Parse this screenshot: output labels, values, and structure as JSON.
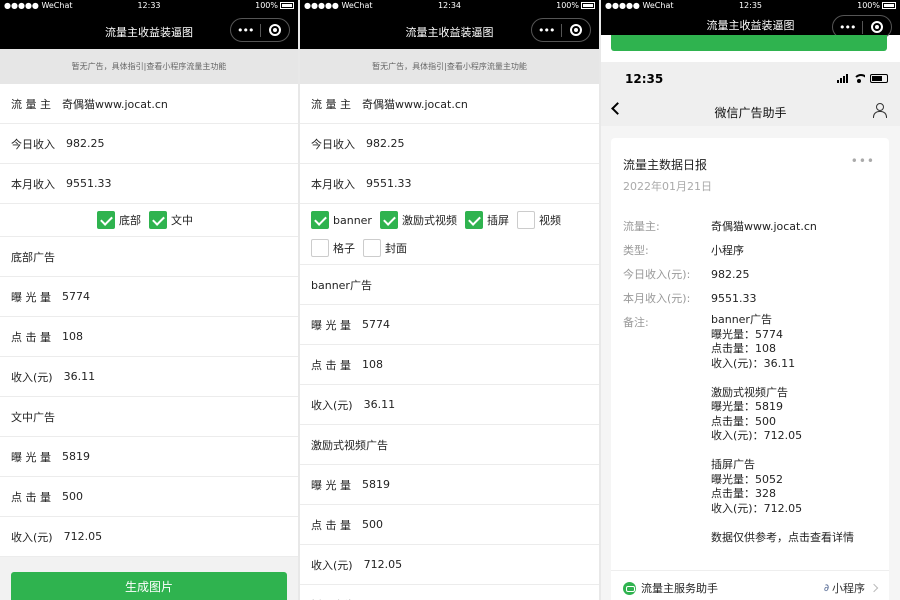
{
  "screens": [
    {
      "status": {
        "left": "●●●●● WeChat",
        "time": "12:33",
        "battery": "100%"
      },
      "nav_title": "流量主收益装逼图",
      "notice": "暂无广告，具体指引|查看小程序流量主功能",
      "rows_top": [
        {
          "label": "流 量 主",
          "value": "奇偶猫www.jocat.cn"
        },
        {
          "label": "今日收入",
          "value": "982.25"
        },
        {
          "label": "本月收入",
          "value": "9551.33"
        }
      ],
      "checks": [
        {
          "label": "底部",
          "checked": true
        },
        {
          "label": "文中",
          "checked": true
        }
      ],
      "sections": [
        {
          "title": "底部广告",
          "rows": [
            {
              "label": "曝 光 量",
              "value": "5774"
            },
            {
              "label": "点 击 量",
              "value": "108"
            },
            {
              "label": "收入(元)",
              "value": "36.11"
            }
          ]
        },
        {
          "title": "文中广告",
          "rows": [
            {
              "label": "曝 光 量",
              "value": "5819"
            },
            {
              "label": "点 击 量",
              "value": "500"
            },
            {
              "label": "收入(元)",
              "value": "712.05"
            }
          ]
        }
      ],
      "button": "生成图片"
    },
    {
      "status": {
        "left": "●●●●● WeChat",
        "time": "12:34",
        "battery": "100%"
      },
      "nav_title": "流量主收益装逼图",
      "notice": "暂无广告，具体指引|查看小程序流量主功能",
      "rows_top": [
        {
          "label": "流 量 主",
          "value": "奇偶猫www.jocat.cn"
        },
        {
          "label": "今日收入",
          "value": "982.25"
        },
        {
          "label": "本月收入",
          "value": "9551.33"
        }
      ],
      "checks_line1": [
        {
          "label": "banner",
          "checked": true
        },
        {
          "label": "激励式视频",
          "checked": true
        },
        {
          "label": "插屏",
          "checked": true
        },
        {
          "label": "视频",
          "checked": false
        }
      ],
      "checks_line2": [
        {
          "label": "格子",
          "checked": false
        },
        {
          "label": "封面",
          "checked": false
        }
      ],
      "sections": [
        {
          "title": "banner广告",
          "rows": [
            {
              "label": "曝 光 量",
              "value": "5774"
            },
            {
              "label": "点 击 量",
              "value": "108"
            },
            {
              "label": "收入(元)",
              "value": "36.11"
            }
          ]
        },
        {
          "title": "激励式视频广告",
          "rows": [
            {
              "label": "曝 光 量",
              "value": "5819"
            },
            {
              "label": "点 击 量",
              "value": "500"
            },
            {
              "label": "收入(元)",
              "value": "712.05"
            }
          ]
        },
        {
          "title": "插屏广告",
          "rows": []
        }
      ]
    },
    {
      "status": {
        "time": "12:35",
        "battery": "100%",
        "left": "●●●●● WeChat"
      },
      "nav_title": "流量主收益装逼图",
      "ios_time": "12:35",
      "nav2_title": "微信广告助手",
      "card": {
        "title": "流量主数据日报",
        "date": "2022年01月21日",
        "more": "•••",
        "fields": [
          {
            "k": "流量主:",
            "v": "奇偶猫www.jocat.cn"
          },
          {
            "k": "类型:",
            "v": "小程序"
          },
          {
            "k": "今日收入(元):",
            "v": "982.25"
          },
          {
            "k": "本月收入(元):",
            "v": "9551.33"
          },
          {
            "k": "备注:",
            "v": ""
          }
        ],
        "note_blocks": [
          [
            "banner广告",
            "曝光量：5774",
            "点击量：108",
            "收入(元)：36.11"
          ],
          [
            "激励式视频广告",
            "曝光量：5819",
            "点击量：500",
            "收入(元)：712.05"
          ],
          [
            "插屏广告",
            "曝光量：5052",
            "点击量：328",
            "收入(元)：712.05"
          ],
          [
            "数据仅供参考，点击查看详情"
          ]
        ],
        "footer_left": "流量主服务助手",
        "footer_right": "小程序"
      }
    }
  ],
  "colors": {
    "green": "#2fb34f",
    "navbar": "#000000",
    "notice_bg": "#e6e6e6"
  }
}
